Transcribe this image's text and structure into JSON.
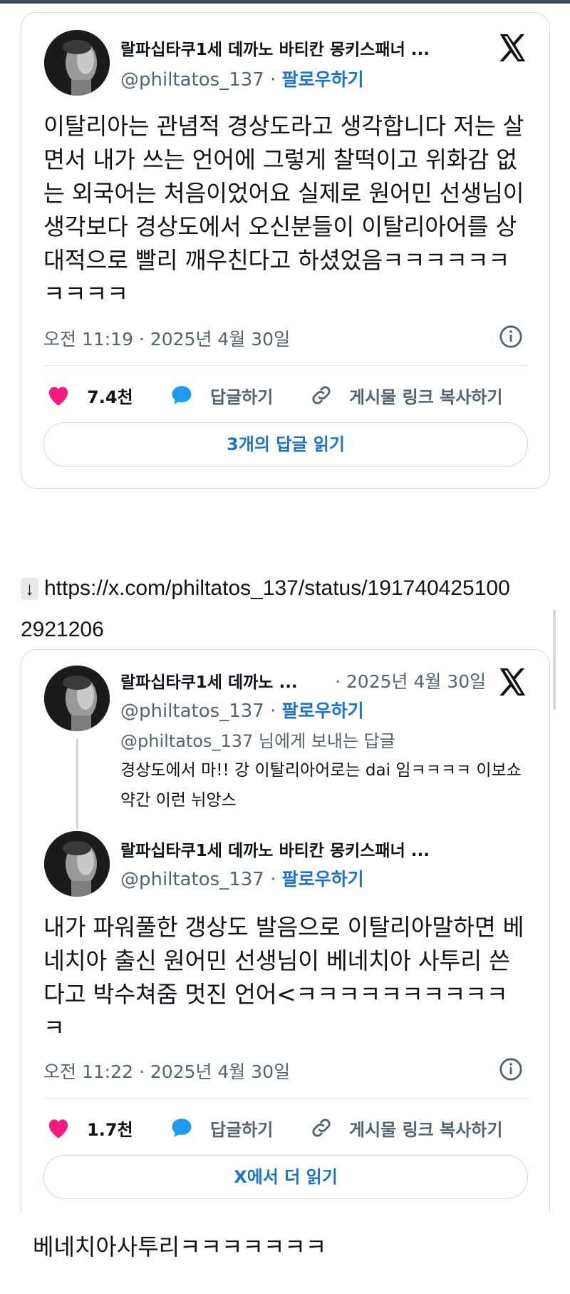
{
  "tweet1": {
    "display_name": "랄파십타쿠1세 데까노 바티칸 몽키스패너 ...",
    "handle": "@philtatos_137",
    "separator": "·",
    "follow_label": "팔로우하기",
    "text": "이탈리아는 관념적 경상도라고 생각합니다 저는 살면서 내가 쓰는 언어에 그렇게 찰떡이고 위화감 없는 외국어는 처음이었어요 실제로 원어민 선생님이 생각보다 경상도에서 오신분들이 이탈리아어를 상대적으로 빨리 깨우친다고 하셨었음ㅋㅋㅋㅋㅋㅋㅋㅋㅋㅋ",
    "timestamp": "오전 11:19 · 2025년 4월 30일",
    "likes": "7.4천",
    "reply_label": "답글하기",
    "copy_link_label": "게시물 링크 복사하기",
    "read_replies_label": "3개의 답글 읽기"
  },
  "link": {
    "arrow": "↓",
    "url_part1": "https://x.com/philtatos_137/status/191740425100",
    "url_part2": "2921206"
  },
  "tweet2": {
    "quoted": {
      "display_name": "랄파십타쿠1세 데까노 ...",
      "date": "· 2025년 4월 30일",
      "handle": "@philtatos_137",
      "separator": "·",
      "follow_label": "팔로우하기",
      "reply_to": "@philtatos_137 님에게 보내는 답글",
      "text": "경상도에서 마!! 강 이탈리아어로는 dai 임ㅋㅋㅋㅋ 이보쇼 약간 이런 뉘앙스"
    },
    "display_name": "랄파십타쿠1세 데까노 바티칸 몽키스패너 ...",
    "handle": "@philtatos_137",
    "separator": "·",
    "follow_label": "팔로우하기",
    "text": "내가 파워풀한 갱상도 발음으로 이탈리아말하면 베네치아 출신 원어민 선생님이 베네치아 사투리 쓴다고 박수쳐줌 멋진 언어<ㅋㅋㅋㅋㅋㅋㅋㅋㅋㅋㅋ",
    "timestamp": "오전 11:22 · 2025년 4월 30일",
    "likes": "1.7천",
    "reply_label": "답글하기",
    "copy_link_label": "게시물 링크 복사하기",
    "read_more_label": "X에서 더 읽기"
  },
  "caption": "베네치아사투리ㅋㅋㅋㅋㅋㅋㅋ",
  "colors": {
    "follow_blue": "#1d73c9",
    "like_pink": "#f91880",
    "reply_blue": "#1d9bf0",
    "muted_gray": "#536471"
  },
  "icons": [
    "x-logo-icon",
    "info-icon",
    "heart-icon",
    "reply-bubble-icon",
    "link-icon",
    "avatar"
  ]
}
